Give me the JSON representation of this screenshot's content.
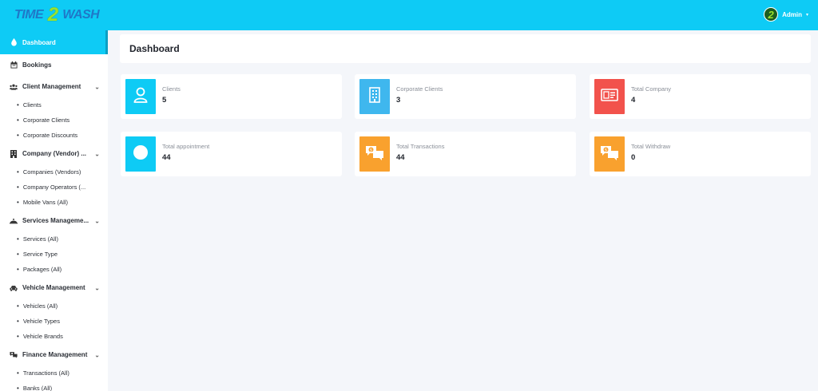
{
  "app": {
    "logo_left": "TIME",
    "logo_mid": "2",
    "logo_right": "WASH",
    "user_name": "Admin",
    "user_caret": "▾",
    "avatar_glyph": "2"
  },
  "sidebar": {
    "dashboard": "Dashboard",
    "bookings": "Bookings",
    "client_mgmt": "Client Management",
    "clients": "Clients",
    "corporate_clients": "Corporate Clients",
    "corporate_discounts": "Corporate Discounts",
    "company_vendor": "Company (Vendor) ...",
    "companies_vendors": "Companies (Vendors)",
    "company_operators": "Company Operators (...",
    "mobile_vans": "Mobile Vans (All)",
    "services_mgmt": "Services Manageme...",
    "services_all": "Services (All)",
    "service_type": "Service Type",
    "packages_all": "Packages (All)",
    "vehicle_mgmt": "Vehicle Management",
    "vehicles_all": "Vehicles (All)",
    "vehicle_types": "Vehicle Types",
    "vehicle_brands": "Vehicle Brands",
    "finance_mgmt": "Finance Management",
    "transactions_all": "Transactions (All)",
    "banks_all": "Banks (All)",
    "bullet": "•",
    "chevron": "⌄"
  },
  "main": {
    "title": "Dashboard"
  },
  "cards": {
    "clients": {
      "label": "Clients",
      "value": "5"
    },
    "corporate_clients": {
      "label": "Corporate Clients",
      "value": "3"
    },
    "total_company": {
      "label": "Total Company",
      "value": "4"
    },
    "total_appointment": {
      "label": "Total appointment",
      "value": "44"
    },
    "total_transactions": {
      "label": "Total Transactions",
      "value": "44"
    },
    "total_withdraw": {
      "label": "Total Withdraw",
      "value": "0"
    }
  },
  "colors": {
    "topbar": "#0ecbf5",
    "cyan": "#0ecbf5",
    "blue": "#3fb7ee",
    "red": "#f2524c",
    "orange": "#f9a12e"
  }
}
